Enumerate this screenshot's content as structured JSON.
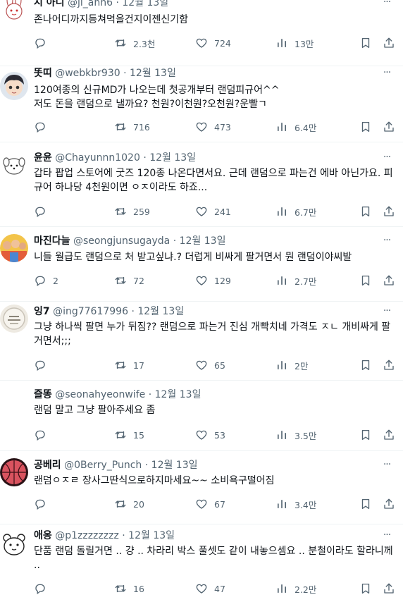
{
  "tweets": [
    {
      "name": "시 아니",
      "handle": "@ji_ann6",
      "date": "12월 13일",
      "text": "존나어디까지등쳐먹을건지이젠신기함",
      "replies": "",
      "retweets": "2.3천",
      "likes": "724",
      "views": "13만",
      "avatar_icon": "rabbit-avatar-icon"
    },
    {
      "name": "똣띠",
      "handle": "@webkbr930",
      "date": "12월 13일",
      "text": "120여종의 신규MD가 나오는데 첫공개부터 랜덤피규어^^\n저도 돈을 랜덤으로 낼까요? 천원?이천원?오천원?운빨ㄱ",
      "replies": "",
      "retweets": "716",
      "likes": "473",
      "views": "6.4만",
      "avatar_icon": "boy-avatar-icon"
    },
    {
      "name": "윤윤",
      "handle": "@Chayunnn1020",
      "date": "12월 13일",
      "text": "갑타 팝업 스토어에 굿즈 120종 나온다면서요. 근데 랜덤으로 파는건 에바 아닌가요. 피규어 하나당 4천원이면 ㅇㅈ이라도 하죠...",
      "replies": "",
      "retweets": "259",
      "likes": "241",
      "views": "6.7만",
      "avatar_icon": "puppy-avatar-icon"
    },
    {
      "name": "마진다늘",
      "handle": "@seongjunsugayda",
      "date": "12월 13일",
      "text": "니들 월급도 랜덤으로 처 받고싶냐.? 더럽게 비싸게 팔거면서 뭔 랜덤이야씨발",
      "replies": "2",
      "retweets": "72",
      "likes": "129",
      "views": "2.7만",
      "avatar_icon": "group-photo-avatar-icon"
    },
    {
      "name": "잉7",
      "handle": "@ing77617996",
      "date": "12월 13일",
      "text": "그냥 하나씩 팔면 누가 뒤짐?? 랜덤으로 파는거 진심 개빡치네 가격도 ㅈㄴ 개비싸게 팔거면서;;;",
      "replies": "",
      "retweets": "17",
      "likes": "65",
      "views": "2만",
      "avatar_icon": "plate-avatar-icon"
    },
    {
      "name": "즐똥",
      "handle": "@seonahyeonwife",
      "date": "12월 13일",
      "text": "랜덤 말고 그냥 팔아주세요 좀",
      "replies": "",
      "retweets": "15",
      "likes": "53",
      "views": "3.5만",
      "avatar_icon": "blank-avatar-icon"
    },
    {
      "name": "공베리",
      "handle": "@0Berry_Punch",
      "date": "12월 13일",
      "text": "랜덤ㅇㅈㄹ 장사그딴식으로하지마세요~~ 소비욕구떨어짐",
      "replies": "",
      "retweets": "20",
      "likes": "67",
      "views": "3.4만",
      "avatar_icon": "basketball-avatar-icon"
    },
    {
      "name": "애옹",
      "handle": "@p1zzzzzzzz",
      "date": "12월 13일",
      "text": "단품 랜덤 돌릴거면 .. 걍 .. 차라리 박스 풀셋도 같이 내놓으셈요 .. 분철이라도 할라니께 ..",
      "replies": "",
      "retweets": "16",
      "likes": "47",
      "views": "2.2만",
      "avatar_icon": "bear-avatar-icon"
    }
  ],
  "icons": {
    "reply": "reply-icon",
    "retweet": "retweet-icon",
    "like": "like-icon",
    "views": "views-icon",
    "bookmark": "bookmark-icon",
    "share": "share-icon",
    "more": "more-icon"
  },
  "more_glyph": "···",
  "separator": "·",
  "colors": {
    "text": "#0f1419",
    "secondary": "#536471",
    "divider": "#eff3f4"
  }
}
